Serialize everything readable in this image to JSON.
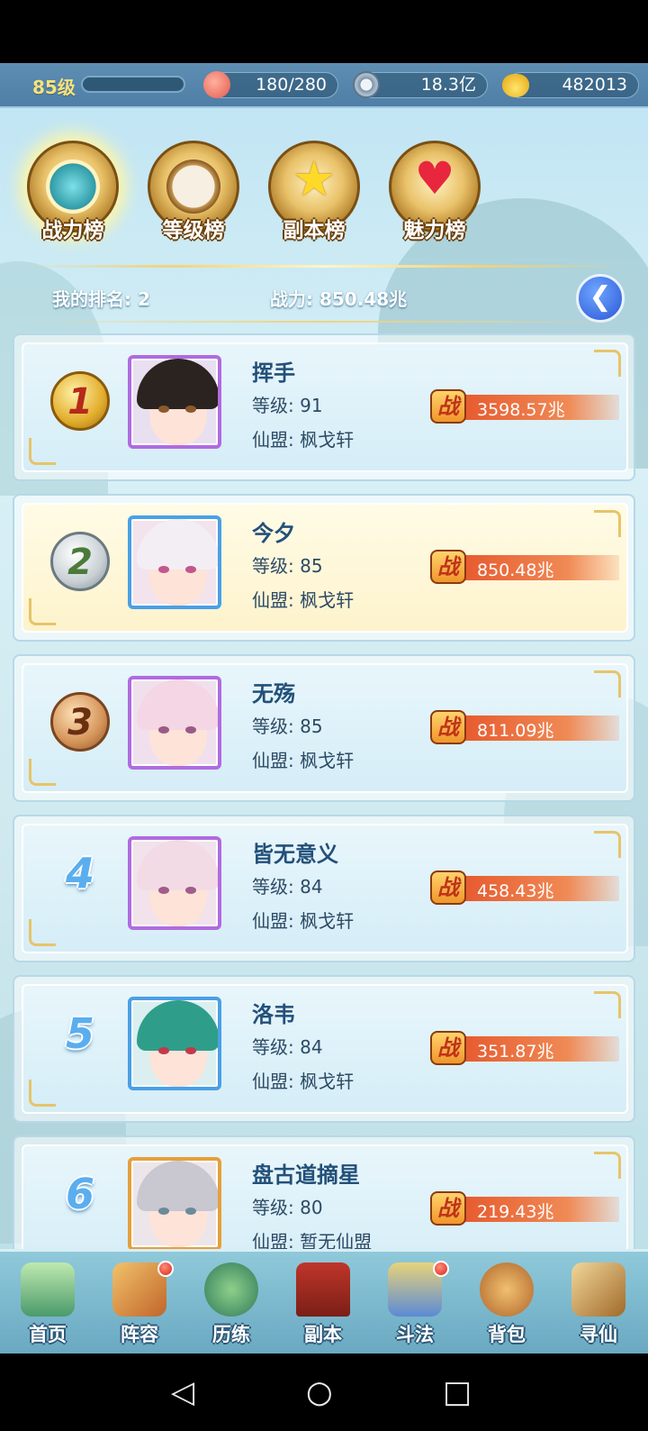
{
  "resources": {
    "level": "85级",
    "stamina": "180/280",
    "coins": "18.3亿",
    "ingots": "482013"
  },
  "tabs": [
    {
      "label": "战力榜",
      "icon": "sword-crest-icon",
      "active": true
    },
    {
      "label": "等级榜",
      "icon": "drum-icon",
      "active": false
    },
    {
      "label": "副本榜",
      "icon": "star-icon",
      "active": false
    },
    {
      "label": "魅力榜",
      "icon": "heart-icon",
      "active": false
    }
  ],
  "my_rank": {
    "rank_text": "我的排名: 2",
    "power_text": "战力: 850.48兆"
  },
  "rankings": [
    {
      "rank": "1",
      "name": "挥手",
      "level": "等级: 91",
      "guild": "仙盟: 枫戈轩",
      "power": "3598.57兆",
      "power_badge": "战"
    },
    {
      "rank": "2",
      "name": "今夕",
      "level": "等级: 85",
      "guild": "仙盟: 枫戈轩",
      "power": "850.48兆",
      "power_badge": "战"
    },
    {
      "rank": "3",
      "name": "无殇",
      "level": "等级: 85",
      "guild": "仙盟: 枫戈轩",
      "power": "811.09兆",
      "power_badge": "战"
    },
    {
      "rank": "4",
      "name": "皆无意义",
      "level": "等级: 84",
      "guild": "仙盟: 枫戈轩",
      "power": "458.43兆",
      "power_badge": "战"
    },
    {
      "rank": "5",
      "name": "洛韦",
      "level": "等级: 84",
      "guild": "仙盟: 枫戈轩",
      "power": "351.87兆",
      "power_badge": "战"
    },
    {
      "rank": "6",
      "name": "盘古道摘星",
      "level": "等级: 80",
      "guild": "仙盟: 暂无仙盟",
      "power": "219.43兆",
      "power_badge": "战"
    }
  ],
  "nav": [
    {
      "label": "首页",
      "icon": "home-island-icon",
      "badge": false
    },
    {
      "label": "阵容",
      "icon": "cards-icon",
      "badge": true
    },
    {
      "label": "历练",
      "icon": "gourd-icon",
      "badge": false
    },
    {
      "label": "副本",
      "icon": "gate-icon",
      "badge": false
    },
    {
      "label": "斗法",
      "icon": "tower-icon",
      "badge": true
    },
    {
      "label": "背包",
      "icon": "bag-icon",
      "badge": false
    },
    {
      "label": "寻仙",
      "icon": "scroll-icon",
      "badge": false
    }
  ],
  "system_nav": {
    "back": "◁",
    "home": "○",
    "recents": "□"
  },
  "colors": {
    "accent_gold": "#e7c46a",
    "power_bar": "#e5542a",
    "name_blue": "#23507a"
  }
}
